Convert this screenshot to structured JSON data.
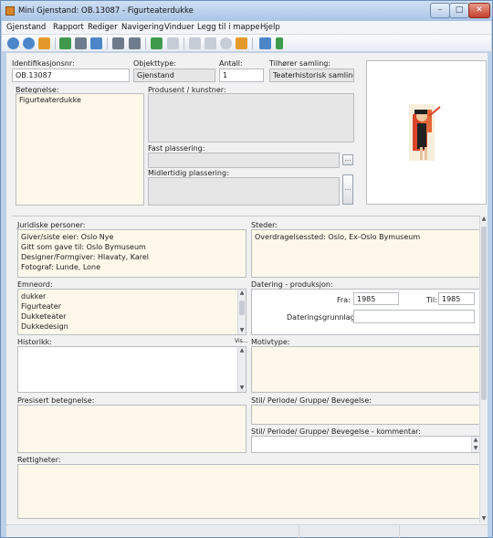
{
  "window": {
    "title": "Mini Gjenstand: OB.13087 - Figurteaterdukke"
  },
  "menu": [
    "Gjenstand",
    "Rapport",
    "Rediger",
    "Navigering",
    "Vinduer",
    "Legg til i mappe",
    "Hjelp"
  ],
  "toolbar": {
    "icons": [
      "zoom-in-icon",
      "zoom-out-icon",
      "search-icon",
      "new-record-icon",
      "copy-record-icon",
      "document-icon",
      "list-view-icon",
      "print-icon",
      "tree-icon",
      "duplicate-icon",
      "edit-icon",
      "approve-icon",
      "cancel-icon",
      "lock-icon",
      "wrench-icon",
      "upload-arrow-icon"
    ]
  },
  "form": {
    "identifikasjonsnr": {
      "label": "Identifikasjonsnr:",
      "value": "OB.13087"
    },
    "objekttype": {
      "label": "Objekttype:",
      "value": "Gjenstand"
    },
    "antall": {
      "label": "Antall:",
      "value": "1"
    },
    "tilhorer_samling": {
      "label": "Tilhører samling:",
      "value": "Teaterhistorisk samling"
    },
    "betegnelse": {
      "label": "Betegnelse:",
      "value": "Figurteaterdukke"
    },
    "produsent": {
      "label": "Produsent / kunstner:",
      "value": ""
    },
    "fast_plassering": {
      "label": "Fast plassering:",
      "value": ""
    },
    "midlertidig_plassering": {
      "label": "Midlertidig plassering:",
      "value": ""
    },
    "juridiske_personer": {
      "label": "Juridiske personer:",
      "lines": [
        "Giver/siste eier: Oslo Nye",
        "Gitt som gave til: Oslo Bymuseum",
        "Designer/Formgiver: Hlavaty, Karel",
        "Fotograf: Lunde, Lone"
      ]
    },
    "steder": {
      "label": "Steder:",
      "lines": [
        "Overdragelsessted: Oslo, Ex-Oslo Bymuseum"
      ]
    },
    "emneord": {
      "label": "Emneord:",
      "items": [
        "dukker",
        "Figurteater",
        "Dukketeater",
        "Dukkedesign"
      ]
    },
    "datering": {
      "label": "Datering - produksjon:",
      "fra_label": "Fra:",
      "fra_value": "1985",
      "til_label": "Til:",
      "til_value": "1985",
      "grunnlag_label": "Dateringsgrunnlag:",
      "grunnlag_value": ""
    },
    "historikk": {
      "label": "Historikk:",
      "vis_label": "Vis...",
      "value": ""
    },
    "motivtype": {
      "label": "Motivtype:",
      "value": ""
    },
    "presisert_betegnelse": {
      "label": "Presisert betegnelse:",
      "value": ""
    },
    "stil": {
      "label": "Stil/ Periode/ Gruppe/ Bevegelse:",
      "value": ""
    },
    "stil_kommentar": {
      "label": "Stil/ Periode/ Gruppe/ Bevegelse  - kommentar:",
      "value": ""
    },
    "rettigheter": {
      "label": "Rettigheter:",
      "value": ""
    }
  },
  "colors": {
    "field_cream": "#fdf8ea",
    "field_grey": "#e6e6e6",
    "window_frame": "#bcd1ea",
    "close_button": "#c4402c"
  }
}
